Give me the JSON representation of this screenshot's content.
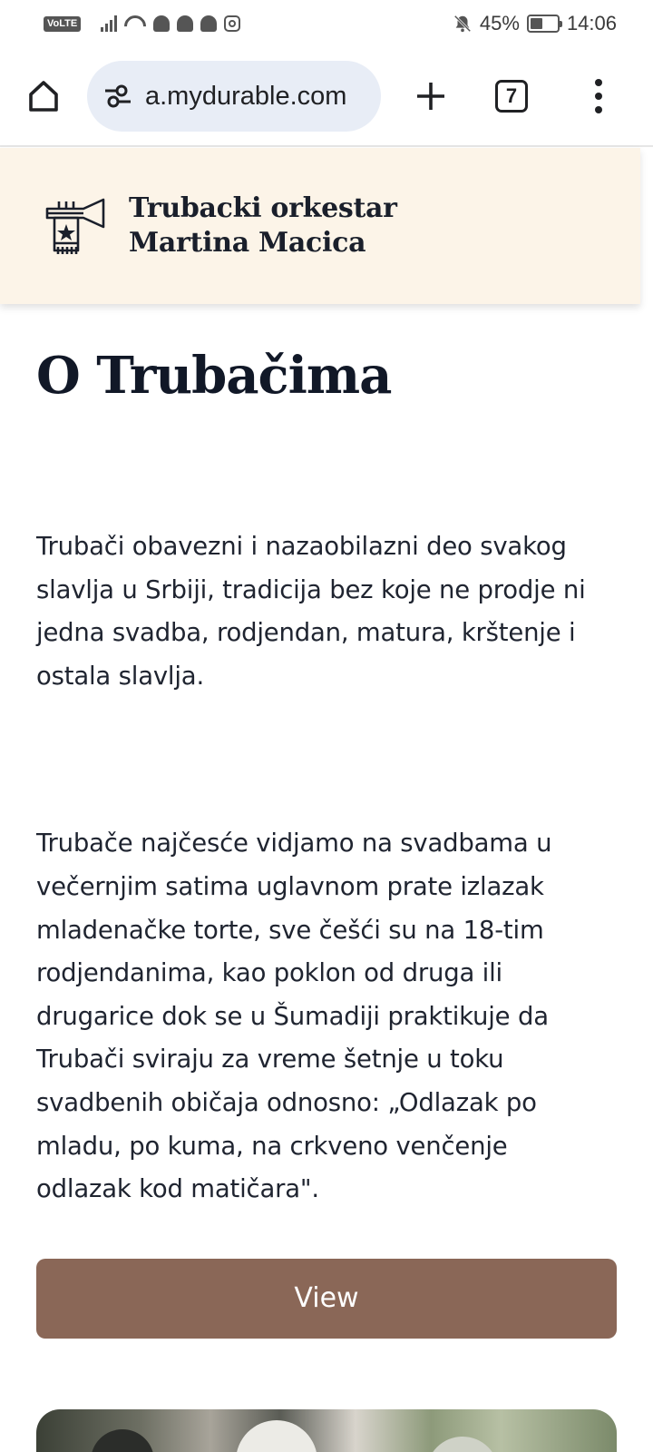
{
  "status_bar": {
    "volte": "VoLTE",
    "battery_percent": "45%",
    "battery_level": 0.45,
    "time": "14:06"
  },
  "browser": {
    "url": "a.mydurable.com",
    "tab_count": "7",
    "icons": [
      "home-icon",
      "site-settings-icon",
      "new-tab-icon",
      "tab-switcher-icon",
      "menu-icon"
    ]
  },
  "site_header": {
    "brand_line1": "Trubacki orkestar",
    "brand_line2": "Martina Macica"
  },
  "main": {
    "title": "O Trubačima",
    "paragraph1": "Trubači obavezni i nazaobilazni deo svakog slavlja u Srbiji, tradicija bez koje ne prodje ni jedna svadba, rodjendan, matura, krštenje i ostala slavlja.",
    "paragraph2": "Trubače najčesće vidjamo na svadbama u večernjim satima uglavnom prate izlazak mladenačke torte, sve češći su na 18-tim rodjendanima, kao poklon od druga ili drugarice dok se u Šumadiji praktikuje da Trubači sviraju za vreme šetnje u toku svadbenih običaja odnosno: „Odlazak po mladu, po kuma, na crkveno venčenje odlazak kod matičara\".",
    "view_button": "View"
  },
  "colors": {
    "header_bg": "#fcf4e8",
    "button_bg": "#8a6757",
    "url_pill_bg": "#e8edf6",
    "text_dark": "#111827"
  }
}
